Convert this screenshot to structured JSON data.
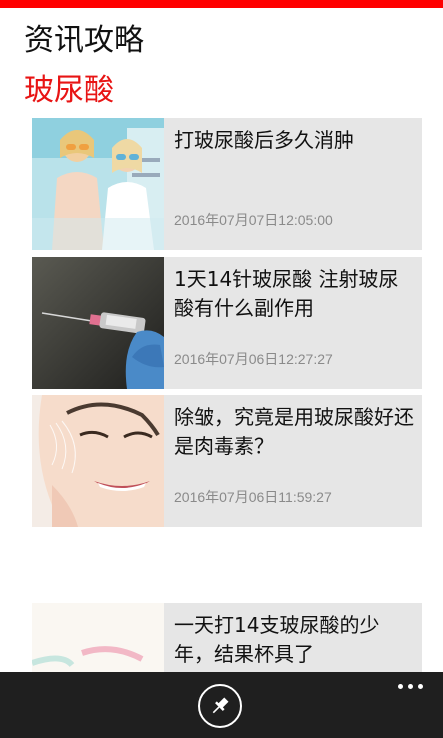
{
  "header": {
    "app_title": "资讯攻略",
    "page_title": "玻尿酸"
  },
  "colors": {
    "accent": "#ff0000",
    "page_title": "#e81414",
    "tile_background": "#e6e6e6",
    "app_bar": "#1f1f1f"
  },
  "articles": [
    {
      "title": "打玻尿酸后多久消肿",
      "date": "2016年07月07日12:05:00"
    },
    {
      "title": "1天14针玻尿酸 注射玻尿酸有什么副作用",
      "date": "2016年07月06日12:27:27"
    },
    {
      "title": "除皱，究竟是用玻尿酸好还是肉毒素？",
      "date": "2016年07月06日11:59:27"
    },
    {
      "title": "一天打14支玻尿酸的少年，结果杯具了",
      "date": ""
    }
  ],
  "app_bar": {
    "pin_icon": "pin-icon",
    "more_icon": "more-icon"
  }
}
